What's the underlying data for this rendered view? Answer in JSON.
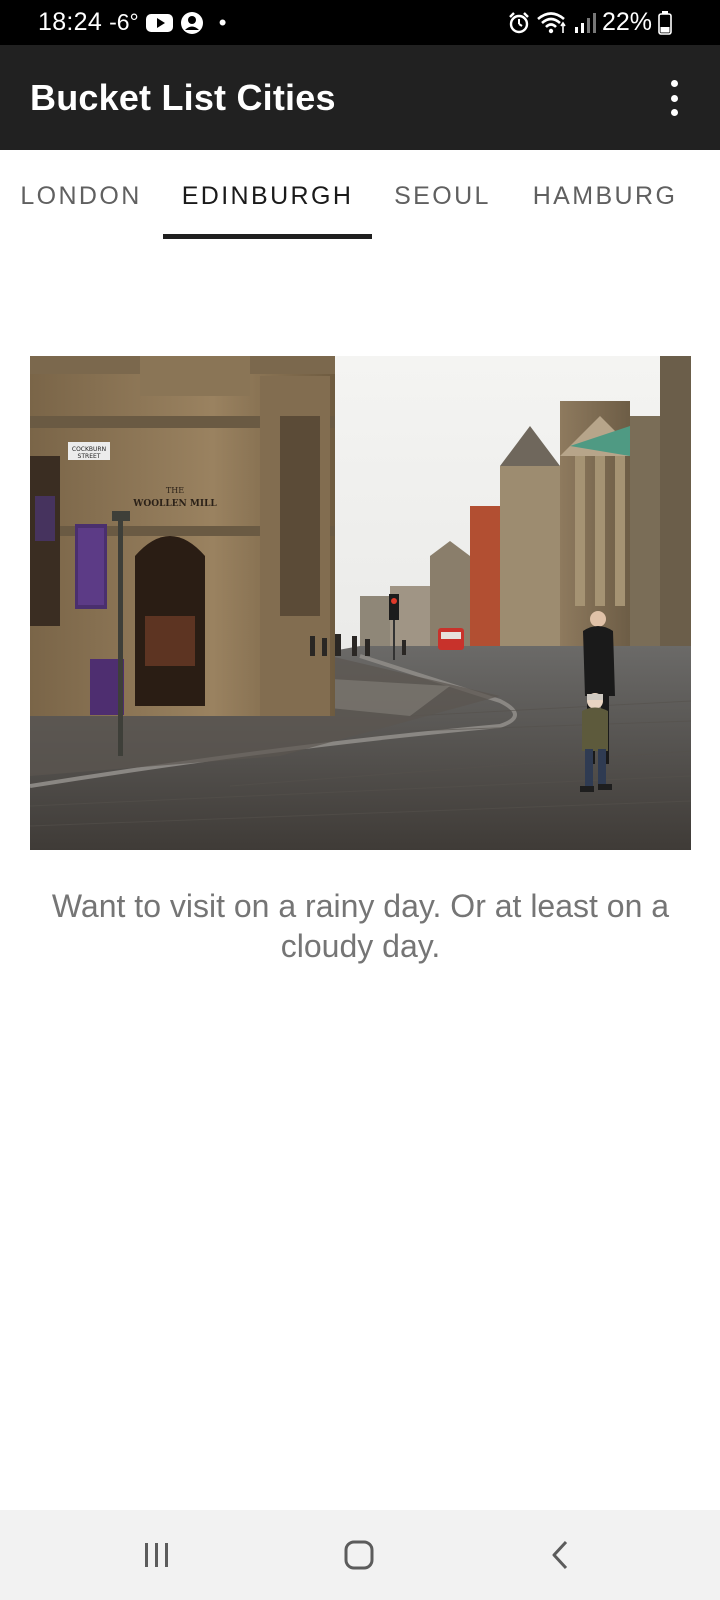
{
  "status_bar": {
    "time": "18:24",
    "temperature": "-6°",
    "notification_dot": "•",
    "battery_percent": "22%",
    "icons": [
      "youtube-icon",
      "account-icon",
      "alarm-icon",
      "wifi-icon",
      "signal-icon",
      "battery-icon"
    ]
  },
  "app_bar": {
    "title": "Bucket List Cities",
    "menu_icon": "overflow-menu-icon"
  },
  "tabs": [
    {
      "label": "LONDON",
      "selected": false
    },
    {
      "label": "EDINBURGH",
      "selected": true
    },
    {
      "label": "SEOUL",
      "selected": false
    },
    {
      "label": "HAMBURG",
      "selected": false
    }
  ],
  "content": {
    "caption": "Want to visit on a rainy day. Or at least on a cloudy day.",
    "sign_cockburn_1": "COCKBURN",
    "sign_cockburn_2": "STREET",
    "sign_woollen_1": "THE",
    "sign_woollen_2": "WOOLLEN MILL"
  },
  "nav_bar": {
    "icons": [
      "recent-apps-icon",
      "home-icon",
      "back-icon"
    ]
  },
  "colors": {
    "status_bar": "#000000",
    "app_bar": "#212121",
    "tab_active_text": "#1a1a1a",
    "tab_inactive_text": "#606060",
    "tab_indicator": "#1f1f1f",
    "caption_text": "#757575",
    "nav_bar": "#f2f2f2"
  }
}
